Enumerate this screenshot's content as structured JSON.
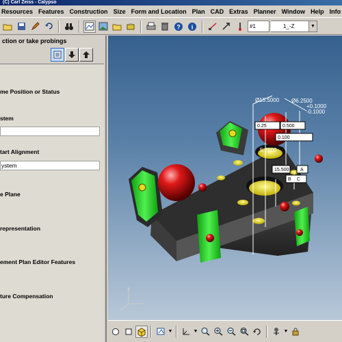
{
  "app": {
    "title": "(C) Carl Zeiss - Calypso"
  },
  "menu": [
    {
      "label": "Resources"
    },
    {
      "label": "Features"
    },
    {
      "label": "Construction"
    },
    {
      "label": "Size"
    },
    {
      "label": "Form and Location"
    },
    {
      "label": "Plan"
    },
    {
      "label": "CAD"
    },
    {
      "label": "Extras"
    },
    {
      "label": "Planner"
    },
    {
      "label": "Window"
    },
    {
      "label": "Help"
    },
    {
      "label": "Info"
    }
  ],
  "toolbar": {
    "icons": [
      "open-folder-icon",
      "save-icon",
      "edit-icon",
      "undo-icon",
      "binoculars-icon",
      "screen-icon",
      "image-icon",
      "folder-icon",
      "tools-icon",
      "print-icon",
      "trash-icon",
      "help-icon",
      "info-icon",
      "measure-icon",
      "arrow-icon",
      "probe-icon"
    ],
    "step_value": "#1",
    "probe_value": "1_-Z"
  },
  "panel": {
    "hint": "ction or take probings",
    "labels": [
      {
        "text": "me Position or Status"
      },
      {
        "text": "stem"
      },
      {
        "text": "tart Alignment"
      },
      {
        "text": "e Plane"
      },
      {
        "text": "representation"
      },
      {
        "text": "ement Plan Editor Features"
      },
      {
        "text": "ture Compensation"
      }
    ],
    "fields": [
      {
        "value": ""
      },
      {
        "value": "ystem"
      }
    ]
  },
  "viewport": {
    "dimensions": [
      "Ø15.5000",
      "Ø6.2500",
      "5.2500",
      "0.25",
      "0.500",
      "0.100",
      "15.500"
    ],
    "feature_boxes": [
      "A",
      "B",
      "C"
    ],
    "tolerance_labels": [
      "+0.1000",
      "-0.1000"
    ]
  },
  "bottom_toolbar": {
    "icons": [
      "circle-icon",
      "square-icon",
      "cube-view-icon",
      "layers-icon",
      "axis-icon",
      "zoom-icon",
      "zoom-in-icon",
      "zoom-out-icon",
      "zoom-fit-icon",
      "rotate-icon",
      "probe-head-icon",
      "lock-icon"
    ]
  },
  "colors": {
    "viewport_top": "#36608e",
    "viewport_bottom": "#b8c8d8",
    "part": "#333333",
    "holes": "#f0e020",
    "spheres": "#cc0000",
    "clamps": "#22cc22"
  }
}
